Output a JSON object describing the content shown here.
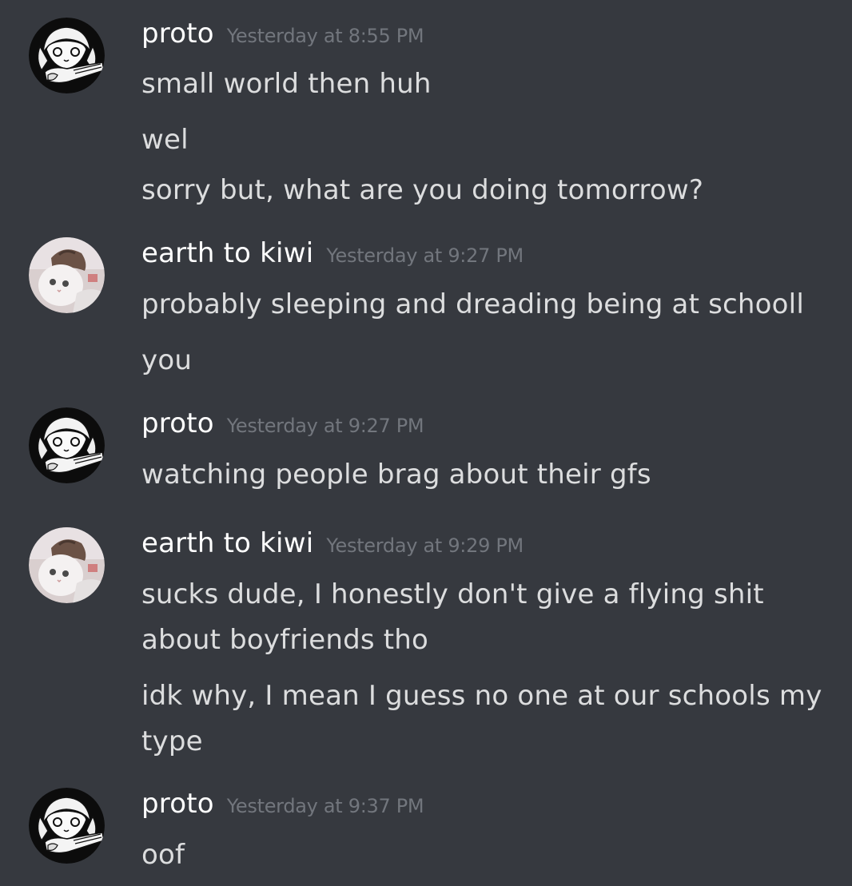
{
  "colors": {
    "background": "#36393f",
    "username": "#ffffff",
    "timestamp": "#72767d",
    "message_text": "#dcddde"
  },
  "messages": [
    {
      "author": "proto",
      "avatar": "manga-girl-avatar-icon",
      "timestamp": "Yesterday at 8:55 PM",
      "lines": [
        "small world then huh",
        "wel",
        "sorry but,  what are you doing tomorrow?"
      ]
    },
    {
      "author": "earth to kiwi",
      "avatar": "cat-avatar-icon",
      "timestamp": "Yesterday at 9:27 PM",
      "lines": [
        "probably sleeping and dreading being at schooll",
        "you"
      ]
    },
    {
      "author": "proto",
      "avatar": "manga-girl-avatar-icon",
      "timestamp": "Yesterday at 9:27 PM",
      "lines": [
        "watching people brag about their gfs"
      ]
    },
    {
      "author": "earth to kiwi",
      "avatar": "cat-avatar-icon",
      "timestamp": "Yesterday at 9:29 PM",
      "lines": [
        "sucks dude, I honestly don't give a flying shit",
        "about boyfriends tho",
        "idk why, I mean I guess no one at our schools my",
        "type"
      ]
    },
    {
      "author": "proto",
      "avatar": "manga-girl-avatar-icon",
      "timestamp": "Yesterday at 9:37 PM",
      "lines": [
        "oof"
      ]
    }
  ]
}
